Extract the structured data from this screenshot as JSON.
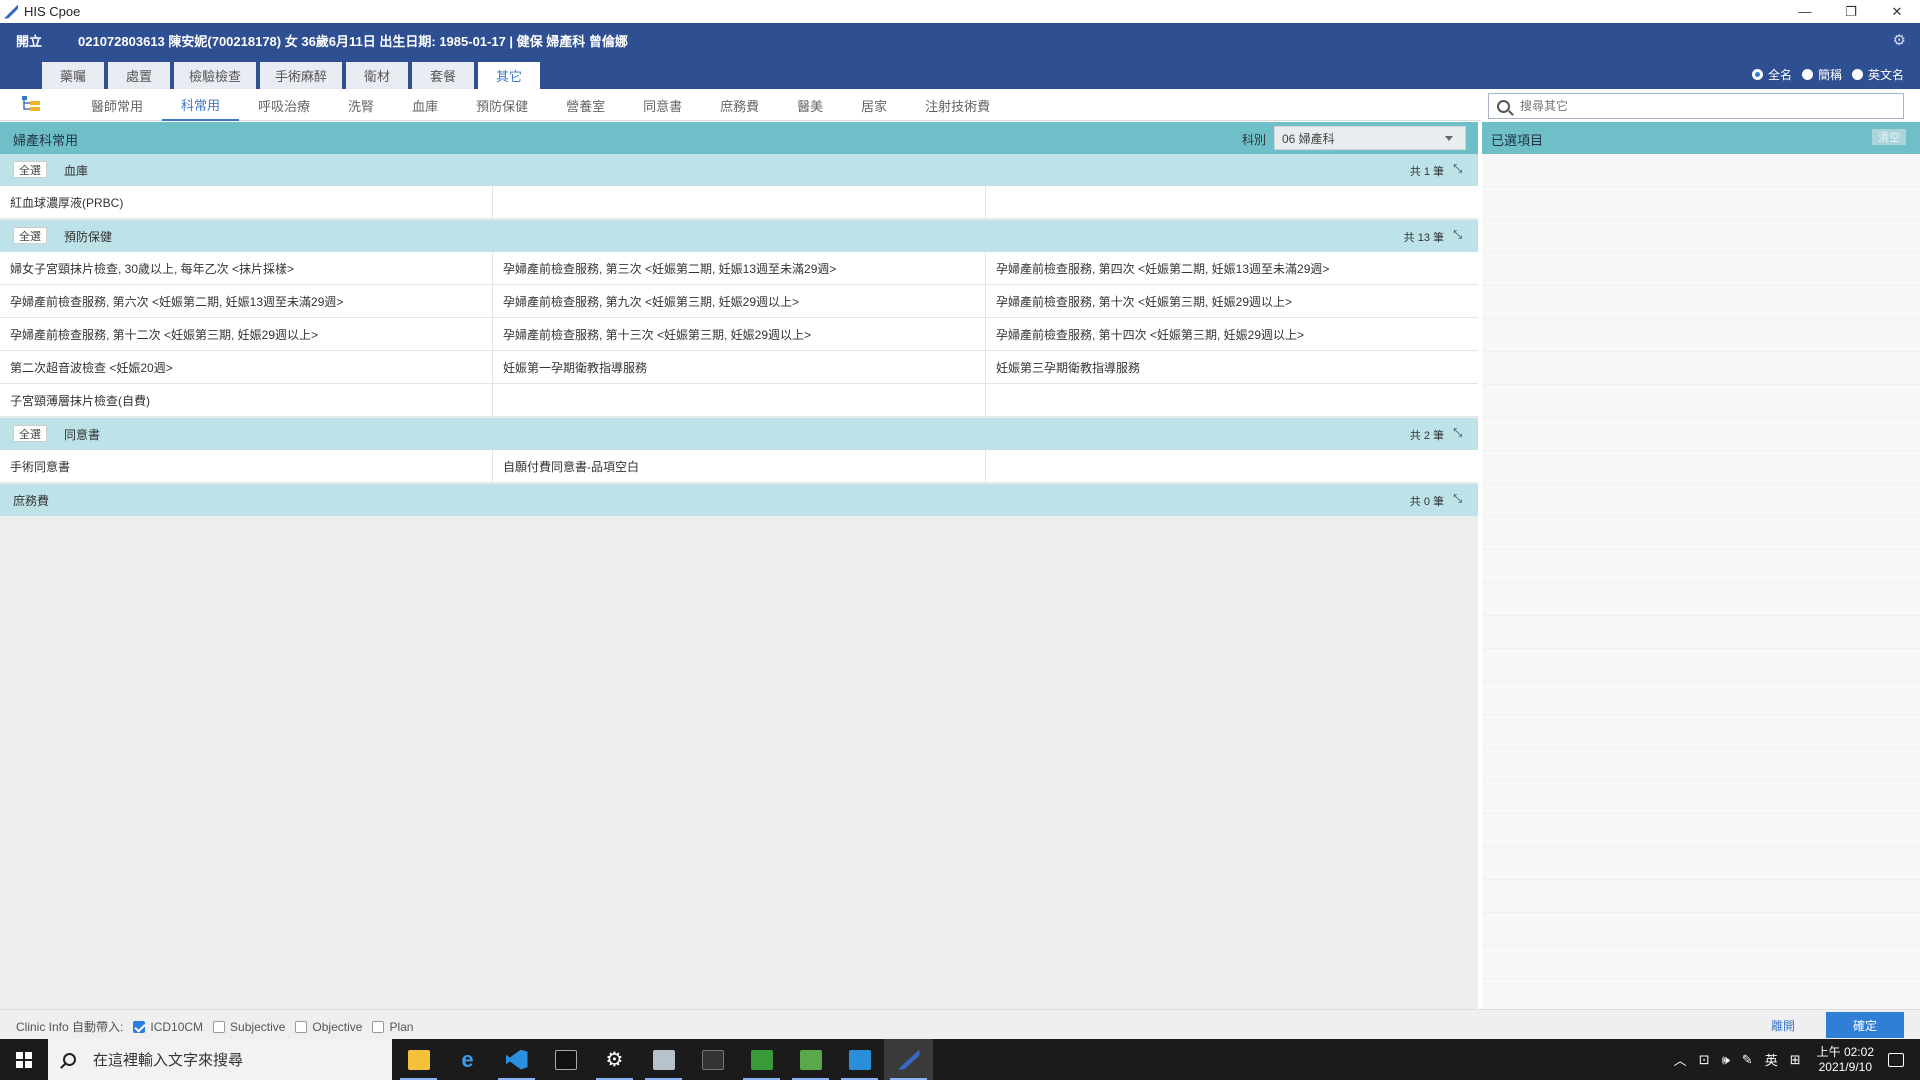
{
  "window": {
    "title": "HIS Cpoe"
  },
  "header": {
    "open_label": "開立",
    "patient_info": "021072803613 陳安妮(700218178) 女 36歲6月11日 出生日期: 1985-01-17 | 健保 婦產科 曾倫娜"
  },
  "main_tabs": [
    "藥囑",
    "處置",
    "檢驗檢查",
    "手術麻醉",
    "衛材",
    "套餐",
    "其它"
  ],
  "main_tab_active": "其它",
  "name_mode": {
    "full": "全名",
    "short": "簡稱",
    "english": "英文名",
    "selected": "全名"
  },
  "sub_tabs": [
    "醫師常用",
    "科常用",
    "呼吸治療",
    "洗腎",
    "血庫",
    "預防保健",
    "營養室",
    "同意書",
    "庶務費",
    "醫美",
    "居家",
    "注射技術費"
  ],
  "sub_tab_active": "科常用",
  "search": {
    "placeholder": "搜尋其它"
  },
  "panel": {
    "title": "婦產科常用",
    "dept_label": "科別",
    "dept_value": "06 婦產科",
    "select_all": "全選"
  },
  "sections": [
    {
      "name": "血庫",
      "count": "共 1 筆",
      "rows": [
        [
          "紅血球濃厚液(PRBC)",
          "",
          ""
        ]
      ]
    },
    {
      "name": "預防保健",
      "count": "共 13 筆",
      "rows": [
        [
          "婦女子宮頸抹片檢查, 30歲以上, 每年乙次 <抹片採樣>",
          "孕婦產前檢查服務, 第三次 <妊娠第二期, 妊娠13週至未滿29週>",
          "孕婦產前檢查服務, 第四次 <妊娠第二期, 妊娠13週至未滿29週>"
        ],
        [
          "孕婦產前檢查服務, 第六次 <妊娠第二期, 妊娠13週至未滿29週>",
          "孕婦產前檢查服務, 第九次 <妊娠第三期, 妊娠29週以上>",
          "孕婦產前檢查服務, 第十次 <妊娠第三期, 妊娠29週以上>"
        ],
        [
          "孕婦產前檢查服務, 第十二次 <妊娠第三期, 妊娠29週以上>",
          "孕婦產前檢查服務, 第十三次 <妊娠第三期, 妊娠29週以上>",
          "孕婦產前檢查服務, 第十四次 <妊娠第三期, 妊娠29週以上>"
        ],
        [
          "第二次超音波檢查 <妊娠20週>",
          "妊娠第一孕期衛教指導服務",
          "妊娠第三孕期衛教指導服務"
        ],
        [
          "子宮頸薄層抹片檢查(自費)",
          "",
          ""
        ]
      ]
    },
    {
      "name": "同意書",
      "count": "共 2 筆",
      "rows": [
        [
          "手術同意書",
          "自願付費同意書-品項空白",
          ""
        ]
      ]
    },
    {
      "name": "庶務費",
      "count": "共 0 筆",
      "rows": []
    }
  ],
  "selected_panel": {
    "title": "已選項目",
    "clear_label": "清空"
  },
  "footer": {
    "clinic_info_label": "Clinic Info 自動帶入:",
    "checks": [
      {
        "label": "ICD10CM",
        "checked": true
      },
      {
        "label": "Subjective",
        "checked": false
      },
      {
        "label": "Objective",
        "checked": false
      },
      {
        "label": "Plan",
        "checked": false
      }
    ],
    "back_label": "離開",
    "confirm_label": "確定"
  },
  "taskbar": {
    "search_text": "在這裡輸入文字來搜尋",
    "apps": [
      "file-explorer",
      "internet-explorer",
      "vscode",
      "command-prompt",
      "settings",
      "printer-app",
      "terminal",
      "green-app-1",
      "green-app-2",
      "media-app",
      "his-cpoe"
    ],
    "ime": "英",
    "time": "上午 02:02",
    "date": "2021/9/10"
  },
  "colors": {
    "header": "#2f4f93",
    "section": "#6fbfc9",
    "subsection": "#bde3e8",
    "accent": "#3d77c7"
  }
}
